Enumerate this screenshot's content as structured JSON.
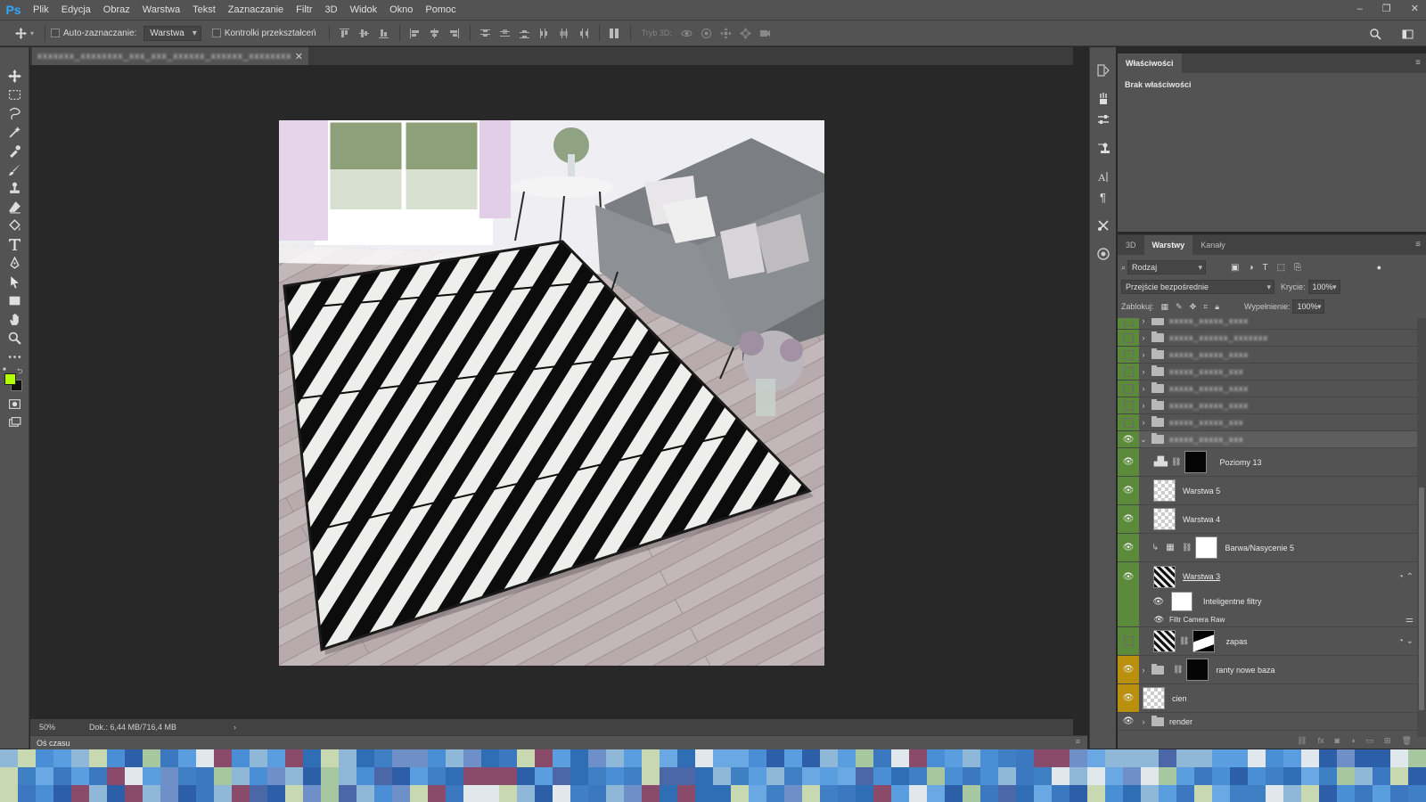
{
  "app": {
    "logo": "Ps"
  },
  "menu": [
    "Plik",
    "Edycja",
    "Obraz",
    "Warstwa",
    "Tekst",
    "Zaznaczanie",
    "Filtr",
    "3D",
    "Widok",
    "Okno",
    "Pomoc"
  ],
  "window_controls": {
    "minimize": "–",
    "restore": "❐",
    "close": "✕"
  },
  "options_bar": {
    "auto_select_label": "Auto-zaznaczanie:",
    "auto_select_value": "Warstwa",
    "transform_controls_label": "Kontrolki przekształceń",
    "mode3d_label": "Tryb 3D:"
  },
  "document": {
    "tab_name": "xxxxxxx_xxxxxxxx_xxx_xxx_xxxxxx_xxxxxx_xxxxxxxx",
    "tab_close": "✕"
  },
  "status": {
    "zoom": "50%",
    "doc_info": "Dok.: 6,44 MB/716,4 MB",
    "arrow": "›"
  },
  "timeline": {
    "label": "Oś czasu",
    "menu": "≡"
  },
  "properties_panel": {
    "tab": "Właściwości",
    "menu": "≡",
    "empty_text": "Brak właściwości"
  },
  "layers_panel": {
    "tabs": [
      "3D",
      "Warstwy",
      "Kanały"
    ],
    "menu": "≡",
    "filter_kind": "Rodzaj",
    "blend_mode": "Przejście bezpośrednie",
    "opacity_label": "Krycie:",
    "opacity_value": "100%",
    "lock_label": "Zablokuj:",
    "fill_label": "Wypełnienie:",
    "fill_value": "100%",
    "layers": [
      {
        "name": "xxxxx_xxxxx_xxxx",
        "blurred": true
      },
      {
        "name": "xxxxx_xxxxxx_xxxxxxx",
        "blurred": true
      },
      {
        "name": "xxxxx_xxxxx_xxxx",
        "blurred": true
      },
      {
        "name": "xxxxx_xxxxx_xxx",
        "blurred": true
      },
      {
        "name": "xxxxx_xxxxx_xxxx",
        "blurred": true
      },
      {
        "name": "xxxxx_xxxxx_xxxx",
        "blurred": true
      },
      {
        "name": "xxxxx_xxxxx_xxx",
        "blurred": true
      },
      {
        "name": "xxxxx_xxxxx_xxx",
        "blurred": true
      },
      {
        "name": "Poziomy 13"
      },
      {
        "name": "Warstwa 5"
      },
      {
        "name": "Warstwa 4"
      },
      {
        "name": "Barwa/Nasycenie 5"
      },
      {
        "name": "Warstwa 3"
      },
      {
        "name": "Inteligentne filtry"
      },
      {
        "name": "Filtr Camera Raw"
      },
      {
        "name": "zapas"
      },
      {
        "name": "ranty nowe baza"
      },
      {
        "name": "cien"
      },
      {
        "name": "render"
      }
    ]
  },
  "colors": {
    "foreground": "#b4ff00",
    "background": "#111111",
    "accent_blue": "#31a8ff"
  }
}
